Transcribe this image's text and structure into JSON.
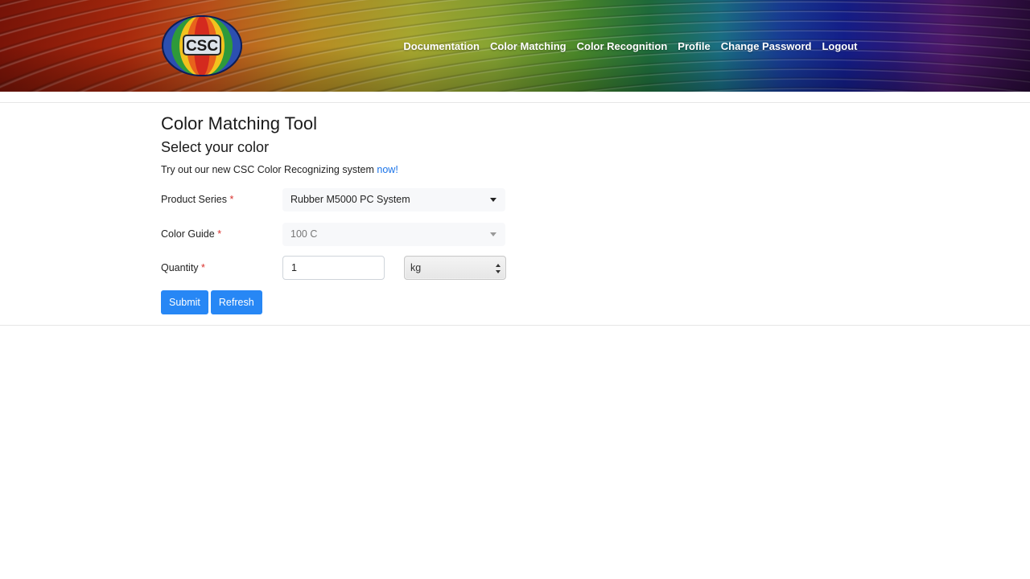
{
  "header": {
    "logo_text": "CSC",
    "nav": [
      "Documentation",
      "Color Matching",
      "Color Recognition",
      "Profile",
      "Change Password",
      "Logout"
    ]
  },
  "main": {
    "title": "Color Matching Tool",
    "subtitle": "Select your color",
    "promo_text": "Try out our new CSC Color Recognizing system ",
    "promo_link": "now!",
    "required_mark": "*",
    "fields": {
      "product_series": {
        "label": "Product Series",
        "value": "Rubber M5000 PC System"
      },
      "color_guide": {
        "label": "Color Guide",
        "value": "100 C"
      },
      "quantity": {
        "label": "Quantity",
        "value": "1",
        "unit": "kg"
      }
    },
    "buttons": {
      "submit": "Submit",
      "refresh": "Refresh"
    }
  },
  "colors": {
    "button": "#2787f5",
    "link": "#1a73e8",
    "required": "#d9302c"
  }
}
